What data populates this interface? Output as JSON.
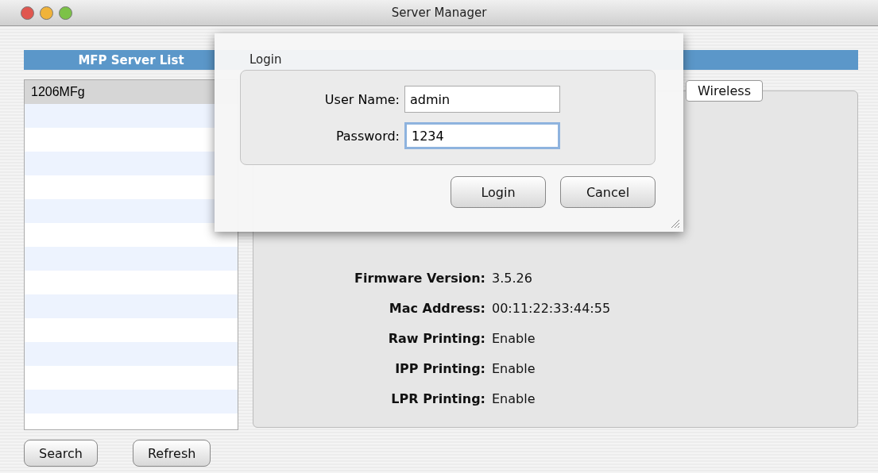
{
  "window": {
    "title": "Server Manager"
  },
  "server_list": {
    "header": "MFP Server List",
    "items": [
      {
        "name": "1206MFg",
        "selected": true
      }
    ]
  },
  "list_buttons": [
    "Search",
    "Refresh"
  ],
  "tabs": [
    {
      "label": "Wireless",
      "selected": true
    }
  ],
  "details": [
    {
      "label": "Firmware Version:",
      "value": "3.5.26"
    },
    {
      "label": "Mac Address:",
      "value": "00:11:22:33:44:55"
    },
    {
      "label": "Raw Printing:",
      "value": "Enable"
    },
    {
      "label": "IPP Printing:",
      "value": "Enable"
    },
    {
      "label": "LPR Printing:",
      "value": "Enable"
    }
  ],
  "login": {
    "group_title": "Login",
    "fields": [
      {
        "label": "User Name:",
        "value": "admin",
        "focused": false
      },
      {
        "label": "Password:",
        "value": "1234",
        "focused": true
      }
    ],
    "buttons": [
      "Login",
      "Cancel"
    ]
  }
}
